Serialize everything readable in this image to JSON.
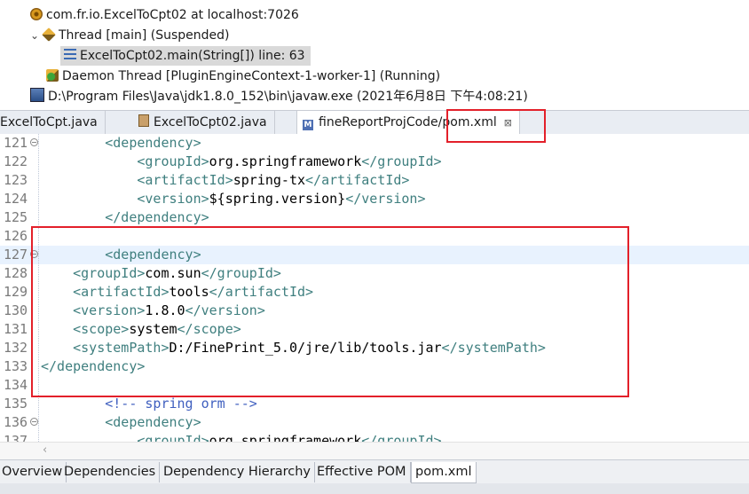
{
  "debug_tree": {
    "rows": [
      {
        "text": "com.fr.io.ExcelToCpt02 at localhost:7026",
        "icon": "debug-target-icon"
      },
      {
        "text": "Thread [main] (Suspended)",
        "icon": "thread-suspended-icon"
      },
      {
        "text": "ExcelToCpt02.main(String[]) line: 63",
        "icon": "stack-frame-icon"
      },
      {
        "text": "Daemon Thread [PluginEngineContext-1-worker-1] (Running)",
        "icon": "thread-running-icon"
      },
      {
        "text": "D:\\Program Files\\Java\\jdk1.8.0_152\\bin\\javaw.exe (2021年6月8日 下午4:08:21)",
        "icon": "jvm-process-icon"
      }
    ]
  },
  "editor_tabs": [
    {
      "label": "ExcelToCpt.java"
    },
    {
      "label": "ExcelToCpt02.java"
    },
    {
      "label": "fineReportProjCode/pom.xml",
      "active": true
    }
  ],
  "editor": {
    "lines": [
      {
        "num": "121",
        "indent": "        ",
        "parts": [
          {
            "t": "tag",
            "v": "<dependency>"
          }
        ]
      },
      {
        "num": "122",
        "indent": "            ",
        "parts": [
          {
            "t": "tag",
            "v": "<groupId>"
          },
          {
            "t": "txt",
            "v": "org.springframework"
          },
          {
            "t": "tag",
            "v": "</groupId>"
          }
        ]
      },
      {
        "num": "123",
        "indent": "            ",
        "parts": [
          {
            "t": "tag",
            "v": "<artifactId>"
          },
          {
            "t": "txt",
            "v": "spring-tx"
          },
          {
            "t": "tag",
            "v": "</artifactId>"
          }
        ]
      },
      {
        "num": "124",
        "indent": "            ",
        "parts": [
          {
            "t": "tag",
            "v": "<version>"
          },
          {
            "t": "txt",
            "v": "${spring.version}"
          },
          {
            "t": "tag",
            "v": "</version>"
          }
        ]
      },
      {
        "num": "125",
        "indent": "        ",
        "parts": [
          {
            "t": "tag",
            "v": "</dependency>"
          }
        ]
      },
      {
        "num": "126",
        "indent": "",
        "parts": []
      },
      {
        "num": "127",
        "indent": "        ",
        "parts": [
          {
            "t": "tag",
            "v": "<dependency>"
          }
        ]
      },
      {
        "num": "128",
        "indent": "    ",
        "parts": [
          {
            "t": "tag",
            "v": "<groupId>"
          },
          {
            "t": "txt",
            "v": "com.sun"
          },
          {
            "t": "tag",
            "v": "</groupId>"
          }
        ]
      },
      {
        "num": "129",
        "indent": "    ",
        "parts": [
          {
            "t": "tag",
            "v": "<artifactId>"
          },
          {
            "t": "txt",
            "v": "tools"
          },
          {
            "t": "tag",
            "v": "</artifactId>"
          }
        ]
      },
      {
        "num": "130",
        "indent": "    ",
        "parts": [
          {
            "t": "tag",
            "v": "<version>"
          },
          {
            "t": "txt",
            "v": "1.8.0"
          },
          {
            "t": "tag",
            "v": "</version>"
          }
        ]
      },
      {
        "num": "131",
        "indent": "    ",
        "parts": [
          {
            "t": "tag",
            "v": "<scope>"
          },
          {
            "t": "txt",
            "v": "system"
          },
          {
            "t": "tag",
            "v": "</scope>"
          }
        ]
      },
      {
        "num": "132",
        "indent": "    ",
        "parts": [
          {
            "t": "tag",
            "v": "<systemPath>"
          },
          {
            "t": "txt",
            "v": "D:/FinePrint_5.0/jre/lib/tools.jar"
          },
          {
            "t": "tag",
            "v": "</systemPath>"
          }
        ]
      },
      {
        "num": "133",
        "indent": "",
        "parts": [
          {
            "t": "tag",
            "v": "</dependency>"
          }
        ]
      },
      {
        "num": "134",
        "indent": "",
        "parts": []
      },
      {
        "num": "135",
        "indent": "        ",
        "parts": [
          {
            "t": "cmt",
            "v": "<!-- spring orm -->"
          }
        ]
      },
      {
        "num": "136",
        "indent": "        ",
        "parts": [
          {
            "t": "tag",
            "v": "<dependency>"
          }
        ]
      },
      {
        "num": "137",
        "indent": "            ",
        "parts": [
          {
            "t": "tag",
            "v": "<groupId>"
          },
          {
            "t": "txt",
            "v": "org.springframework"
          },
          {
            "t": "tag",
            "v": "</groupId>"
          }
        ]
      }
    ],
    "fold_lines": [
      "121",
      "127",
      "136"
    ],
    "current_line": "127"
  },
  "bottom_tabs": [
    {
      "label": "Overview"
    },
    {
      "label": "Dependencies"
    },
    {
      "label": "Dependency Hierarchy"
    },
    {
      "label": "Effective POM"
    },
    {
      "label": "pom.xml",
      "active": true
    }
  ],
  "colors": {
    "xml_tag": "#3f7f7f",
    "xml_comment": "#3f5fbf",
    "highlight_box": "#e3202a",
    "current_line": "#e8f2fe"
  }
}
